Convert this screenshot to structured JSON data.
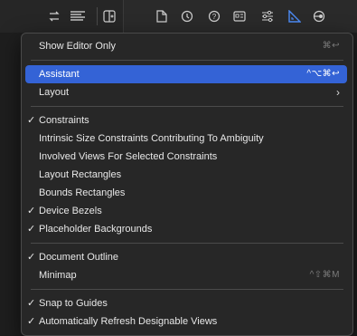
{
  "toolbar": {
    "icons": [
      "swap-arrows-icon",
      "editor-lines-icon",
      "add-editor-icon",
      "file-inspector-icon",
      "history-icon",
      "help-icon",
      "identity-icon",
      "attributes-icon",
      "size-ruler-icon",
      "connections-icon"
    ],
    "accent": "#4c8bf5"
  },
  "menu": {
    "items": [
      {
        "label": "Show Editor Only",
        "shortcut": "⌘↩",
        "checked": false
      },
      {
        "label": "Assistant",
        "shortcut": "^⌥⌘↩",
        "checked": false,
        "highlighted": true
      },
      {
        "label": "Layout",
        "shortcut": "",
        "submenu": true,
        "checked": false
      },
      {
        "label": "Constraints",
        "shortcut": "",
        "checked": true
      },
      {
        "label": "Intrinsic Size Constraints Contributing To Ambiguity",
        "shortcut": "",
        "checked": false
      },
      {
        "label": "Involved Views For Selected Constraints",
        "shortcut": "",
        "checked": false
      },
      {
        "label": "Layout Rectangles",
        "shortcut": "",
        "checked": false
      },
      {
        "label": "Bounds Rectangles",
        "shortcut": "",
        "checked": false
      },
      {
        "label": "Device Bezels",
        "shortcut": "",
        "checked": true
      },
      {
        "label": "Placeholder Backgrounds",
        "shortcut": "",
        "checked": true
      },
      {
        "label": "Document Outline",
        "shortcut": "",
        "checked": true
      },
      {
        "label": "Minimap",
        "shortcut": "^⇧⌘M",
        "checked": false
      },
      {
        "label": "Snap to Guides",
        "shortcut": "",
        "checked": true
      },
      {
        "label": "Automatically Refresh Designable Views",
        "shortcut": "",
        "checked": true
      }
    ],
    "check_glyph": "✓",
    "submenu_glyph": "›",
    "highlight_color": "#3463d6"
  }
}
